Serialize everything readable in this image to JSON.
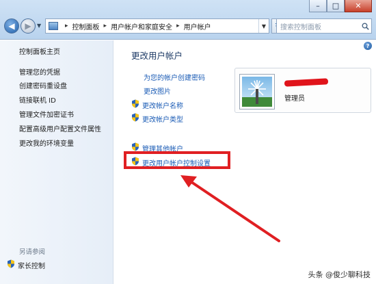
{
  "window": {
    "minimize_glyph": "–",
    "maximize_glyph": "□",
    "close_glyph": "✕"
  },
  "address_bar": {
    "crumbs": [
      "控制面板",
      "用户帐户和家庭安全",
      "用户帐户"
    ],
    "separator": "▸",
    "search_placeholder": "搜索控制面板"
  },
  "sidebar": {
    "items": [
      "控制面板主页",
      "管理您的凭据",
      "创建密码重设盘",
      "链接联机 ID",
      "管理文件加密证书",
      "配置高级用户配置文件属性",
      "更改我的环境变量"
    ],
    "see_also": "另请参阅",
    "family_safety": "家长控制"
  },
  "main": {
    "heading": "更改用户帐户",
    "tasks": {
      "create_password": "为您的帐户创建密码",
      "change_picture": "更改图片",
      "change_name": "更改帐户名称",
      "change_type": "更改帐户类型",
      "manage_other": "管理其他帐户",
      "uac_settings": "更改用户帐户控制设置"
    },
    "account_role": "管理员"
  },
  "watermark": "头条 @俊少聊科技",
  "colors": {
    "accent_red": "#e01f22",
    "link_blue": "#1a5bb5",
    "heading_blue": "#1e3b66"
  }
}
